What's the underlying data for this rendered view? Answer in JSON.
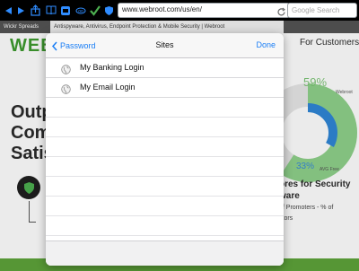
{
  "browser": {
    "url": "www.webroot.com/us/en/",
    "search_placeholder": "Google Search",
    "tabs": [
      {
        "label": "Wickr Spreads"
      },
      {
        "label": "Antispyware, Antivirus, Endpoint Protection & Mobile Security | Webroot"
      }
    ]
  },
  "page": {
    "logo": "WEB",
    "nav_link": "For Customers",
    "hero_lines": [
      "Outp",
      "Comp",
      "Satis"
    ],
    "stats": {
      "primary_percent": "59%",
      "primary_label": "Webroot",
      "primary_value": 59,
      "secondary_percent": "33%",
      "secondary_label": "AVG Free",
      "secondary_value": 33
    },
    "promo_title_lines": [
      "ores for Security",
      "ware"
    ],
    "promo_note_lines": [
      "of Promoters - % of",
      "ctors"
    ]
  },
  "popover": {
    "back_label": "Password",
    "title": "Sites",
    "done_label": "Done",
    "sites": [
      {
        "label": "My Banking Login",
        "icon": "globe-icon"
      },
      {
        "label": "My Email Login",
        "icon": "globe-icon"
      }
    ]
  },
  "colors": {
    "accent": "#1a7ef5",
    "brand_green": "#3e9b2f"
  }
}
